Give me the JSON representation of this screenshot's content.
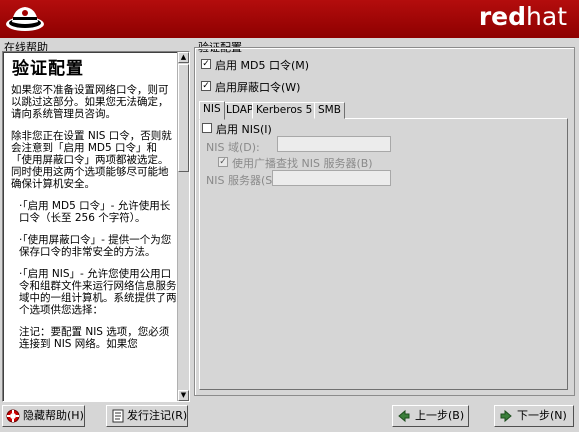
{
  "header": {
    "brand_bold": "red",
    "brand_normal": "hat",
    "logo_icon": "redhat-shadowman-icon"
  },
  "help": {
    "caption": "在线帮助",
    "title": "验证配置",
    "paragraphs": [
      "如果您不准备设置网络口令，则可以跳过这部分。如果您无法确定，请向系统管理员咨询。",
      "除非您正在设置 NIS 口令，否则就会注意到「启用 MD5 口令」和「使用屏蔽口令」两项都被选定。同时使用这两个选项能够尽可能地确保计算机安全。",
      "·「启用 MD5 口令」- 允许使用长口令（长至 256 个字符）。",
      "·「使用屏蔽口令」- 提供一个为您保存口令的非常安全的方法。",
      "·「启用 NIS」- 允许您使用公用口令和组群文件来运行网络信息服务域中的一组计算机。系统提供了两个选项供您选择：",
      "注记：要配置 NIS 选项，您必须连接到 NIS 网络。如果您"
    ]
  },
  "config": {
    "caption": "验证配置",
    "md5": {
      "label": "启用 MD5 口令",
      "key": "(M)",
      "checked": true
    },
    "shadow": {
      "label": "启用屏蔽口令",
      "key": "(W)",
      "checked": true
    },
    "tabs": [
      "NIS",
      "LDAP",
      "Kerberos 5",
      "SMB"
    ],
    "nis": {
      "enable_label": "启用 NIS",
      "enable_key": "(I)",
      "domain_label": "NIS 域",
      "domain_key": "(D)",
      "domain_suffix": ":",
      "domain_value": "",
      "broadcast_label": "使用广播查找 NIS 服务器",
      "broadcast_key": "(B)",
      "server_label": "NIS 服务器",
      "server_key": "(S)",
      "server_value": ""
    }
  },
  "buttons": {
    "hide_help": {
      "label": "隐藏帮助",
      "key": "(H)",
      "icon": "lifebuoy-icon"
    },
    "release_notes": {
      "label": "发行注记",
      "key": "(R)",
      "icon": "document-icon"
    },
    "back": {
      "label": "上一步",
      "key": "(B)",
      "icon": "arrow-left-icon"
    },
    "next": {
      "label": "下一步",
      "key": "(N)",
      "icon": "arrow-right-icon"
    }
  }
}
